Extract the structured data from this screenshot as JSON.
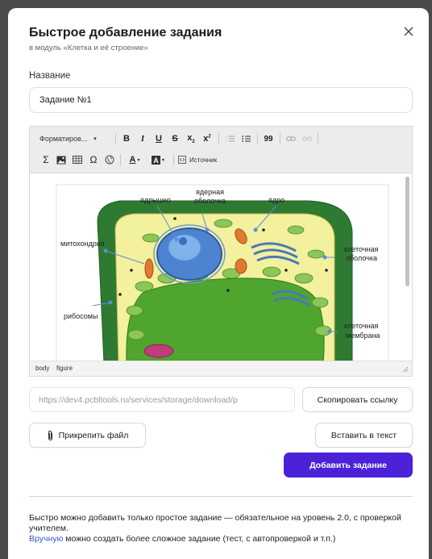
{
  "modal": {
    "title": "Быстрое добавление задания",
    "subtitle": "в модуль «Клетка и её строение»"
  },
  "name_field": {
    "label": "Название",
    "value": "Задание №1"
  },
  "editor": {
    "toolbar": {
      "format_label": "Форматиров...",
      "source_label": "Источник",
      "bold": "B",
      "italic": "I",
      "underline": "U",
      "strike": "S",
      "quote": "99",
      "sigma": "Σ",
      "omega": "Ω",
      "text_color": "A"
    },
    "status_path": [
      "body",
      "figure"
    ],
    "image_labels": {
      "nucleolus": "ядрышко",
      "nuclear_envelope_1": "ядерная",
      "nuclear_envelope_2": "оболочка",
      "nucleus": "ядро",
      "mitochondria": "митохондрия",
      "cell_wall_1": "клеточная",
      "cell_wall_2": "оболочка",
      "ribosomes": "рибосомы",
      "cell_membrane_1": "клеточная",
      "cell_membrane_2": "мембрана"
    }
  },
  "link": {
    "url": "https://dev4.pcbltools.ru/services/storage/download/p",
    "copy_label": "Скопировать ссылку"
  },
  "actions": {
    "attach_label": "Прикрепить файл",
    "insert_label": "Вставить в текст",
    "add_label": "Добавить задание"
  },
  "note": {
    "line1": "Быстро можно добавить только простое задание — обязательное на уровень 2.0, с проверкой учителем.",
    "link_text": "Вручную",
    "line2_rest": " можно создать более сложное задание (тест, с автопроверкой и т.п.)"
  },
  "colors": {
    "accent": "#4b22d8",
    "link": "#2e54d8",
    "cell_wall": "#2f7d35",
    "cytoplasm": "#f4f1a0",
    "vacuole": "#3f9a2a"
  }
}
